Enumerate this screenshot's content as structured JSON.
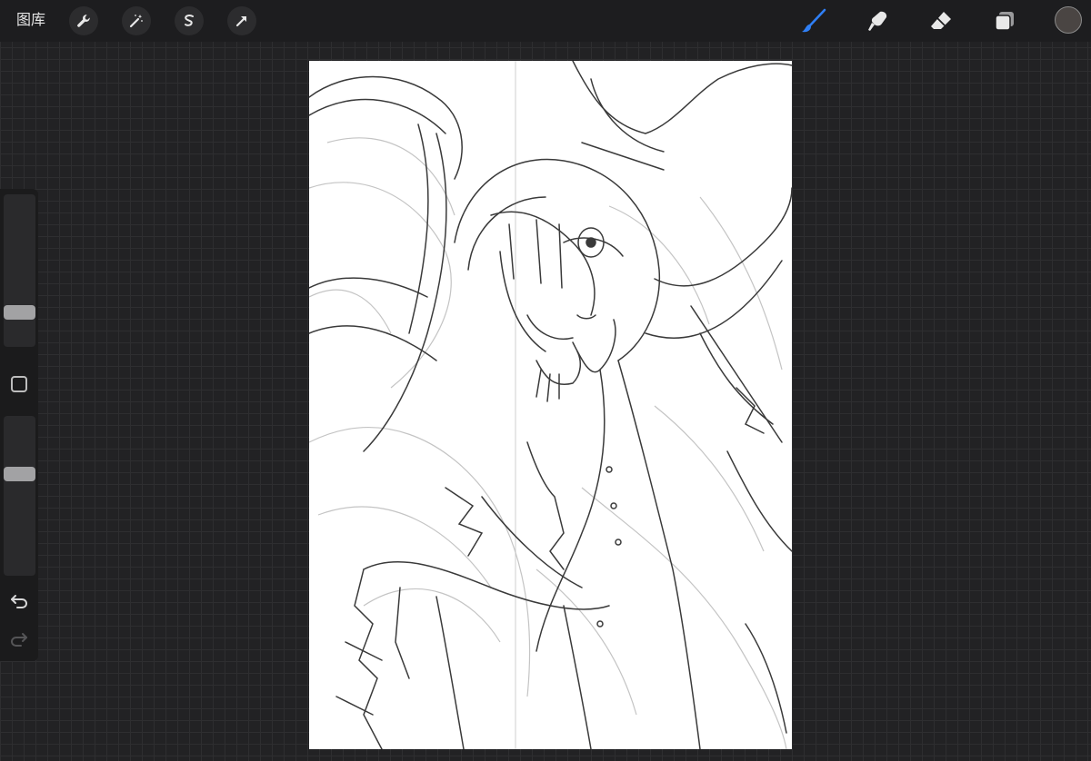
{
  "toolbar": {
    "gallery_label": "图库",
    "left_tools": [
      "wrench-icon",
      "magic-wand-icon",
      "selection-icon",
      "transform-arrow-icon"
    ],
    "right_tools": [
      "brush-icon",
      "smudge-icon",
      "eraser-icon",
      "layers-icon"
    ],
    "active_tool": "brush-icon",
    "active_tool_color": "#2f7ff5",
    "current_color": "#4a4543"
  },
  "sidebar": {
    "brush_size": 0.2,
    "opacity": 0.65,
    "buttons": [
      "modify-button",
      "undo-icon",
      "redo-icon"
    ]
  },
  "canvas": {
    "content": "sketch-drawing"
  }
}
